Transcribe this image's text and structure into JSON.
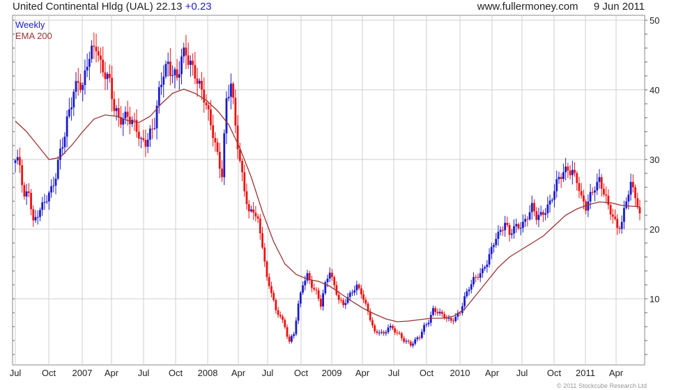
{
  "header": {
    "symbol_label": "United Continental Hldg (UAL)",
    "last_price": "22.13",
    "change": "+0.23",
    "website": "www.fullermoney.com",
    "date": "9 Jun 2011"
  },
  "legend": {
    "series1": "Weekly",
    "series2": "EMA 200"
  },
  "footer": {
    "copyright": "© 2011 Stockcube Research Ltd"
  },
  "colors": {
    "up": "#1a1acc",
    "down": "#ee1111",
    "ema": "#993333",
    "grid": "#cfcfcf"
  },
  "chart_data": {
    "type": "candlestick",
    "x_ticks": [
      "Jul",
      "Oct",
      "2007",
      "Apr",
      "Jul",
      "Oct",
      "2008",
      "Apr",
      "Jul",
      "Oct",
      "2009",
      "Apr",
      "Jul",
      "Oct",
      "2010",
      "Apr",
      "Jul",
      "Oct",
      "2011",
      "Apr"
    ],
    "y_ticks": [
      10,
      20,
      30,
      40,
      50
    ],
    "ylim": [
      0,
      50
    ],
    "grid": true,
    "series": [
      {
        "name": "Weekly",
        "kind": "weekly candlesticks",
        "weekly_close": [
          [
            0,
            29.5
          ],
          [
            2,
            29
          ],
          [
            4,
            24.5
          ],
          [
            6,
            26
          ],
          [
            8,
            21
          ],
          [
            10,
            22
          ],
          [
            12,
            23
          ],
          [
            14,
            24.5
          ],
          [
            16,
            26
          ],
          [
            18,
            28
          ],
          [
            20,
            31
          ],
          [
            22,
            33
          ],
          [
            24,
            37
          ],
          [
            26,
            40
          ],
          [
            28,
            42
          ],
          [
            30,
            40
          ],
          [
            32,
            43.5
          ],
          [
            34,
            45
          ],
          [
            36,
            47
          ],
          [
            38,
            44
          ],
          [
            40,
            42.5
          ],
          [
            42,
            40.5
          ],
          [
            44,
            37
          ],
          [
            46,
            36
          ],
          [
            48,
            36.5
          ],
          [
            50,
            36.5
          ],
          [
            52,
            35
          ],
          [
            54,
            34
          ],
          [
            56,
            32.5
          ],
          [
            58,
            33
          ],
          [
            60,
            34
          ],
          [
            62,
            35
          ],
          [
            64,
            39
          ],
          [
            66,
            42.5
          ],
          [
            68,
            44
          ],
          [
            70,
            43
          ],
          [
            72,
            41.5
          ],
          [
            74,
            44
          ],
          [
            76,
            45
          ],
          [
            78,
            44
          ],
          [
            80,
            43
          ],
          [
            82,
            40.5
          ],
          [
            84,
            38.5
          ],
          [
            86,
            36
          ],
          [
            88,
            34
          ],
          [
            90,
            31
          ],
          [
            92,
            28
          ],
          [
            94,
            38
          ],
          [
            96,
            40.5
          ],
          [
            98,
            35
          ],
          [
            100,
            30
          ],
          [
            102,
            26
          ],
          [
            104,
            22
          ],
          [
            106,
            22.5
          ],
          [
            108,
            21
          ],
          [
            110,
            18
          ],
          [
            112,
            13
          ],
          [
            114,
            11
          ],
          [
            116,
            8
          ],
          [
            118,
            7.5
          ],
          [
            120,
            6
          ],
          [
            122,
            4
          ],
          [
            124,
            5
          ],
          [
            126,
            9
          ],
          [
            128,
            12
          ],
          [
            130,
            13.5
          ],
          [
            132,
            12
          ],
          [
            134,
            11
          ],
          [
            136,
            9
          ],
          [
            138,
            12
          ],
          [
            140,
            14
          ],
          [
            142,
            12
          ],
          [
            144,
            10
          ],
          [
            146,
            9
          ],
          [
            148,
            10
          ],
          [
            150,
            11
          ],
          [
            152,
            12
          ],
          [
            154,
            11
          ],
          [
            156,
            9
          ],
          [
            158,
            7
          ],
          [
            160,
            5
          ],
          [
            162,
            5.5
          ],
          [
            164,
            5
          ],
          [
            166,
            6
          ],
          [
            168,
            5.5
          ],
          [
            170,
            5
          ],
          [
            172,
            4.5
          ],
          [
            174,
            4
          ],
          [
            176,
            3.5
          ],
          [
            178,
            3.8
          ],
          [
            180,
            4.5
          ],
          [
            182,
            6
          ],
          [
            184,
            7
          ],
          [
            186,
            8.5
          ],
          [
            188,
            8
          ],
          [
            190,
            7.5
          ],
          [
            192,
            7.2
          ],
          [
            194,
            7
          ],
          [
            196,
            7.5
          ],
          [
            198,
            8
          ],
          [
            200,
            10
          ],
          [
            202,
            11.5
          ],
          [
            204,
            13
          ],
          [
            206,
            13.5
          ],
          [
            208,
            14
          ],
          [
            210,
            15
          ],
          [
            212,
            17
          ],
          [
            214,
            19
          ],
          [
            216,
            20
          ],
          [
            218,
            21
          ],
          [
            220,
            19
          ],
          [
            222,
            20
          ],
          [
            224,
            20.5
          ],
          [
            226,
            21
          ],
          [
            228,
            22
          ],
          [
            230,
            23
          ],
          [
            232,
            21.5
          ],
          [
            234,
            22
          ],
          [
            236,
            23
          ],
          [
            238,
            24
          ],
          [
            240,
            25.5
          ],
          [
            242,
            27
          ],
          [
            244,
            28
          ],
          [
            246,
            29
          ],
          [
            248,
            28.5
          ],
          [
            250,
            27
          ],
          [
            252,
            24
          ],
          [
            254,
            23
          ],
          [
            256,
            25
          ],
          [
            258,
            26.5
          ],
          [
            260,
            27
          ],
          [
            262,
            25
          ],
          [
            264,
            23
          ],
          [
            266,
            22
          ],
          [
            268,
            20.5
          ],
          [
            270,
            21
          ],
          [
            272,
            24
          ],
          [
            274,
            26
          ],
          [
            276,
            25
          ],
          [
            278,
            22.1
          ]
        ]
      },
      {
        "name": "EMA 200",
        "kind": "line",
        "points": [
          [
            0,
            35.5
          ],
          [
            5,
            34
          ],
          [
            10,
            32
          ],
          [
            15,
            30
          ],
          [
            20,
            30.3
          ],
          [
            25,
            32
          ],
          [
            30,
            34
          ],
          [
            35,
            35.8
          ],
          [
            40,
            36.4
          ],
          [
            45,
            36.2
          ],
          [
            50,
            35.6
          ],
          [
            55,
            35.3
          ],
          [
            60,
            36.2
          ],
          [
            65,
            38
          ],
          [
            70,
            39.5
          ],
          [
            75,
            40.1
          ],
          [
            80,
            39.5
          ],
          [
            85,
            38.5
          ],
          [
            90,
            37
          ],
          [
            95,
            35
          ],
          [
            100,
            31.6
          ],
          [
            105,
            27.5
          ],
          [
            110,
            22.5
          ],
          [
            115,
            18.2
          ],
          [
            120,
            15
          ],
          [
            125,
            13.5
          ],
          [
            130,
            12.8
          ],
          [
            135,
            12.5
          ],
          [
            140,
            11.8
          ],
          [
            145,
            10.7
          ],
          [
            150,
            9.6
          ],
          [
            155,
            8.6
          ],
          [
            160,
            7.8
          ],
          [
            165,
            7.1
          ],
          [
            170,
            6.7
          ],
          [
            175,
            6.8
          ],
          [
            180,
            7
          ],
          [
            185,
            7.2
          ],
          [
            190,
            7.2
          ],
          [
            195,
            7.5
          ],
          [
            200,
            8.5
          ],
          [
            205,
            10.5
          ],
          [
            210,
            12.5
          ],
          [
            215,
            14.5
          ],
          [
            220,
            16
          ],
          [
            225,
            17
          ],
          [
            230,
            18
          ],
          [
            235,
            19
          ],
          [
            240,
            20.5
          ],
          [
            245,
            22
          ],
          [
            250,
            22.9
          ],
          [
            255,
            23.5
          ],
          [
            260,
            23.9
          ],
          [
            265,
            23.8
          ],
          [
            270,
            23.4
          ],
          [
            278,
            23.2
          ]
        ]
      }
    ]
  }
}
